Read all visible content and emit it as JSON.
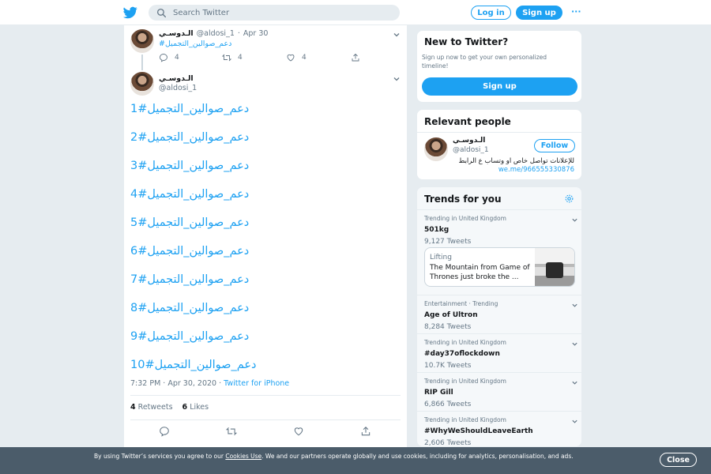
{
  "nav": {
    "search_placeholder": "Search Twitter",
    "login_label": "Log in",
    "signup_label": "Sign up",
    "more_icon": "···"
  },
  "thread": {
    "parent": {
      "display_name": "الـدوسـي",
      "handle": "@aldosi_1",
      "dot": "·",
      "date": "Apr 30",
      "text": "#دعم_صوالين_التجميل",
      "replies": "4",
      "retweets": "4",
      "likes": "4"
    },
    "main": {
      "display_name": "الـدوسـي",
      "handle": "@aldosi_1",
      "lines": [
        "1#دعم_صوالين_التجميل",
        "2#دعم_صوالين_التجميل",
        "3#دعم_صوالين_التجميل",
        "4#دعم_صوالين_التجميل",
        "5#دعم_صوالين_التجميل",
        "6#دعم_صوالين_التجميل",
        "7#دعم_صوالين_التجميل",
        "8#دعم_صوالين_التجميل",
        "9#دعم_صوالين_التجميل",
        "10#دعم_صوالين_التجميل"
      ],
      "time": "7:32 PM · Apr 30, 2020",
      "meta_sep": "·",
      "client": "Twitter for iPhone",
      "retweet_count": "4",
      "retweet_label": "Retweets",
      "like_count": "6",
      "like_label": "Likes"
    }
  },
  "sidebar": {
    "new_to_twitter": {
      "title": "New to Twitter?",
      "text": "Sign up now to get your own personalized timeline!",
      "button": "Sign up"
    },
    "relevant": {
      "title": "Relevant people",
      "display_name": "الـدوسـي",
      "handle": "@aldosi_1",
      "follow_label": "Follow",
      "bio": "للإعلانات تواصل خاص او وتساب ع الرابط",
      "link": "we.me/966555330876"
    },
    "trends": {
      "title": "Trends for you",
      "items": [
        {
          "context": "Trending in United Kingdom",
          "name": "501kg",
          "count": "9,127 Tweets"
        },
        {
          "context": "Entertainment · Trending",
          "name": "Age of Ultron",
          "count": "8,284 Tweets"
        },
        {
          "context": "Trending in United Kingdom",
          "name": "#day37oflockdown",
          "count": "10.7K Tweets"
        },
        {
          "context": "Trending in United Kingdom",
          "name": "RIP Gill",
          "count": "6,866 Tweets"
        },
        {
          "context": "Trending in United Kingdom",
          "name": "#WhyWeShouldLeaveEarth",
          "count": "2,606 Tweets"
        }
      ],
      "moment": {
        "category": "Lifting",
        "text": "The Mountain from Game of Thrones just broke the ..."
      }
    }
  },
  "cookie": {
    "before": "By using Twitter’s services you agree to our ",
    "link": "Cookies Use",
    "after": ". We and our partners operate globally and use cookies, including for analytics, personalisation, and ads.",
    "close_label": "Close"
  },
  "colors": {
    "accent": "#1da1f2",
    "background": "#e6ecf0",
    "cookie_bar": "#4b5c6a"
  }
}
